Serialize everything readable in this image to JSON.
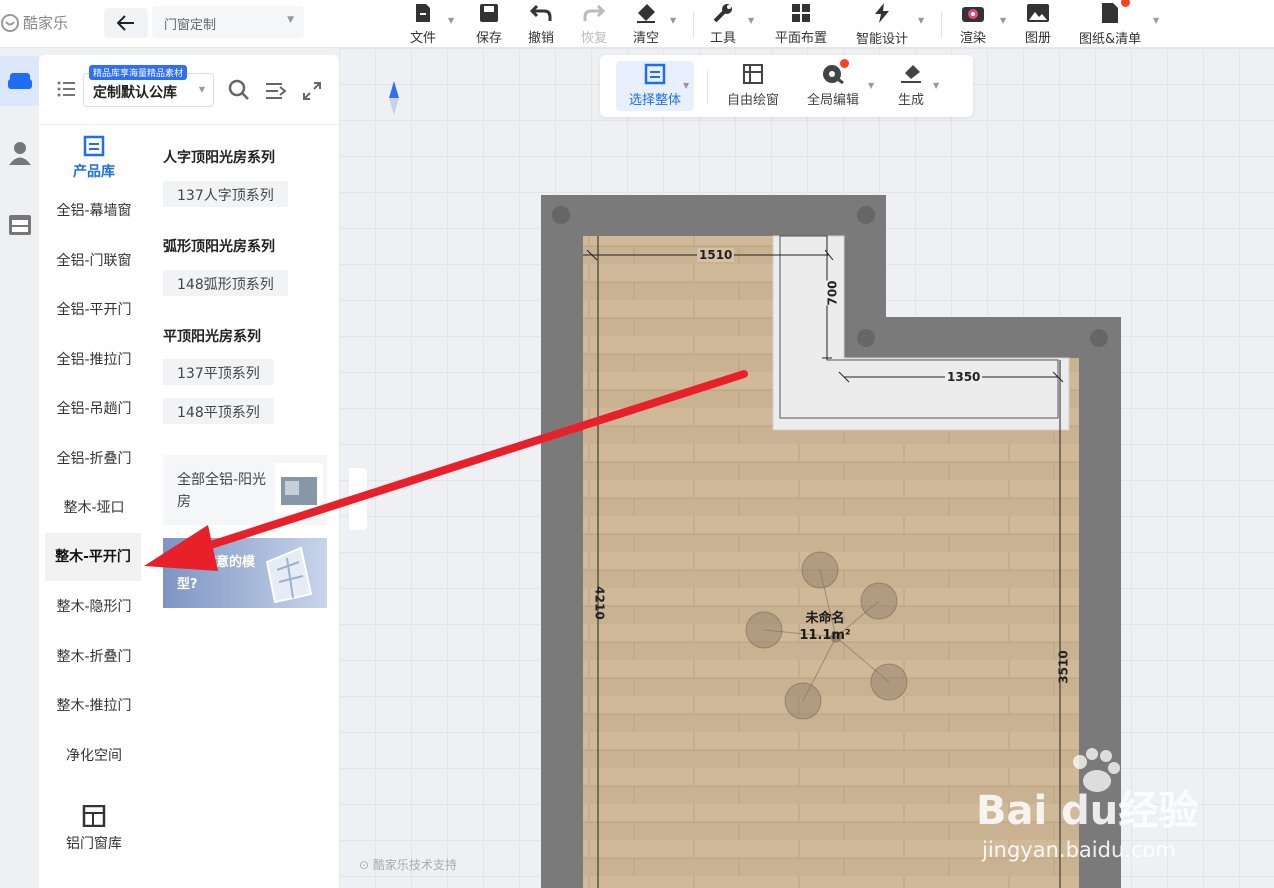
{
  "app": {
    "logo_text": "酷家乐",
    "mode_select": "门窗定制"
  },
  "toolbar": {
    "file": "文件",
    "save": "保存",
    "undo": "撤销",
    "redo": "恢复",
    "clear": "清空",
    "tools": "工具",
    "floor_plan": "平面布置",
    "smart_design": "智能设计",
    "render": "渲染",
    "album": "图册",
    "drawings": "图纸&清单"
  },
  "subtoolbar": {
    "select_all": "选择整体",
    "free_draw": "自由绘窗",
    "global_edit": "全局编辑",
    "generate": "生成"
  },
  "library": {
    "tag": "精品库享海量精品素材",
    "selected": "定制默认公库",
    "product_tab": "产品库",
    "categories": [
      "全铝-幕墙窗",
      "全铝-门联窗",
      "全铝-平开门",
      "全铝-推拉门",
      "全铝-吊趟门",
      "全铝-折叠门",
      "整木-垭口",
      "整木-平开门",
      "整木-隐形门",
      "整木-折叠门",
      "整木-推拉门",
      "净化空间"
    ],
    "active_category": "整木-平开门",
    "aluminum_lib": "铝门窗库"
  },
  "series": {
    "groups": [
      {
        "title": "人字顶阳光房系列",
        "items": [
          "137人字顶系列"
        ]
      },
      {
        "title": "弧形顶阳光房系列",
        "items": [
          "148弧形顶系列"
        ]
      },
      {
        "title": "平顶阳光房系列",
        "items": [
          "137平顶系列",
          "148平顶系列"
        ]
      }
    ],
    "card_all": "全部全铝-阳光房",
    "card_promo": "没有满意的模型?"
  },
  "plan": {
    "room_name": "未命名",
    "area": "11.1m²",
    "dims": {
      "top": "1510",
      "notch_v": "700",
      "notch_h": "1350",
      "left": "4210",
      "right": "3510"
    },
    "support": "酷家乐技术支持"
  },
  "watermark": {
    "brand": "Bai du经验",
    "url": "jingyan.baidu.com"
  },
  "colors": {
    "accent": "#1f6ef2",
    "arrow": "#e8202a",
    "wall": "#7a7a7a",
    "floor": "#c9b291"
  }
}
